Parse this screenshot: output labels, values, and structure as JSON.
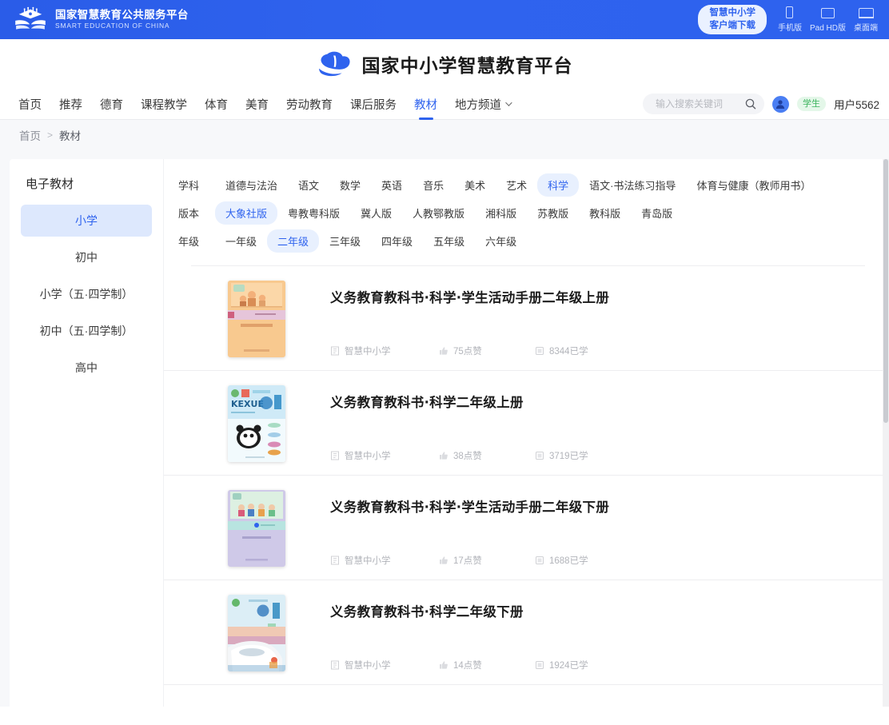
{
  "topbar": {
    "brand_cn": "国家智慧教育公共服务平台",
    "brand_en": "SMART EDUCATION OF CHINA",
    "download_pill_line1": "智慧中小学",
    "download_pill_line2": "客户端下载",
    "platforms": [
      {
        "label": "手机版",
        "icon": "phone-icon"
      },
      {
        "label": "Pad HD版",
        "icon": "tablet-icon"
      },
      {
        "label": "桌面端",
        "icon": "desktop-icon"
      }
    ],
    "accent": "#2f63ee"
  },
  "logo_row": {
    "site_title": "国家中小学智慧教育平台",
    "logo_icon": "cloud-logo-icon"
  },
  "nav": {
    "items": [
      {
        "label": "首页",
        "active": false
      },
      {
        "label": "推荐",
        "active": false
      },
      {
        "label": "德育",
        "active": false
      },
      {
        "label": "课程教学",
        "active": false
      },
      {
        "label": "体育",
        "active": false
      },
      {
        "label": "美育",
        "active": false
      },
      {
        "label": "劳动教育",
        "active": false
      },
      {
        "label": "课后服务",
        "active": false
      },
      {
        "label": "教材",
        "active": true
      },
      {
        "label": "地方频道",
        "active": false,
        "has_caret": true
      }
    ],
    "search": {
      "placeholder": "输入搜索关键词",
      "value": "",
      "icon": "search-icon"
    },
    "user": {
      "role_badge": "学生",
      "username": "用户5562",
      "avatar_icon": "user-avatar-icon"
    }
  },
  "breadcrumb": {
    "home": "首页",
    "separator": ">",
    "current": "教材"
  },
  "sidebar": {
    "title": "电子教材",
    "items": [
      {
        "label": "小学",
        "active": true
      },
      {
        "label": "初中",
        "active": false
      },
      {
        "label": "小学（五·四学制）",
        "active": false
      },
      {
        "label": "初中（五·四学制）",
        "active": false
      },
      {
        "label": "高中",
        "active": false
      }
    ]
  },
  "filters": [
    {
      "label": "学科",
      "chips": [
        {
          "label": "道德与法治",
          "active": false
        },
        {
          "label": "语文",
          "active": false
        },
        {
          "label": "数学",
          "active": false
        },
        {
          "label": "英语",
          "active": false
        },
        {
          "label": "音乐",
          "active": false
        },
        {
          "label": "美术",
          "active": false
        },
        {
          "label": "艺术",
          "active": false
        },
        {
          "label": "科学",
          "active": true
        },
        {
          "label": "语文·书法练习指导",
          "active": false
        },
        {
          "label": "体育与健康（教师用书）",
          "active": false
        }
      ]
    },
    {
      "label": "版本",
      "chips": [
        {
          "label": "大象社版",
          "active": true
        },
        {
          "label": "粤教粤科版",
          "active": false
        },
        {
          "label": "冀人版",
          "active": false
        },
        {
          "label": "人教鄂教版",
          "active": false
        },
        {
          "label": "湘科版",
          "active": false
        },
        {
          "label": "苏教版",
          "active": false
        },
        {
          "label": "教科版",
          "active": false
        },
        {
          "label": "青岛版",
          "active": false
        }
      ]
    },
    {
      "label": "年级",
      "chips": [
        {
          "label": "一年级",
          "active": false
        },
        {
          "label": "二年级",
          "active": true
        },
        {
          "label": "三年级",
          "active": false
        },
        {
          "label": "四年级",
          "active": false
        },
        {
          "label": "五年级",
          "active": false
        },
        {
          "label": "六年级",
          "active": false
        }
      ]
    }
  ],
  "books": [
    {
      "title": "义务教育教科书·科学·学生活动手册二年级上册",
      "publisher": "智慧中小学",
      "likes": "75点赞",
      "studied": "8344已学",
      "cover": "cover-orange-kids"
    },
    {
      "title": "义务教育教科书·科学二年级上册",
      "publisher": "智慧中小学",
      "likes": "38点赞",
      "studied": "3719已学",
      "cover": "cover-panda-blue"
    },
    {
      "title": "义务教育教科书·科学·学生活动手册二年级下册",
      "publisher": "智慧中小学",
      "likes": "17点赞",
      "studied": "1688已学",
      "cover": "cover-purple-kids"
    },
    {
      "title": "义务教育教科书·科学二年级下册",
      "publisher": "智慧中小学",
      "likes": "14点赞",
      "studied": "1924已学",
      "cover": "cover-train"
    }
  ]
}
